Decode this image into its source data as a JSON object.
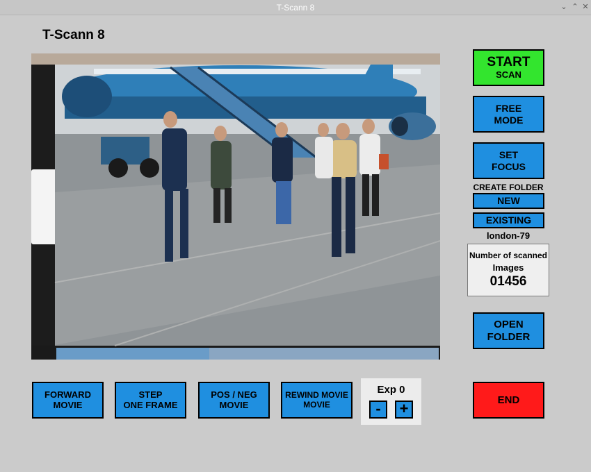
{
  "window": {
    "title": "T-Scann 8"
  },
  "app": {
    "title": "T-Scann 8"
  },
  "buttons": {
    "start_line1": "START",
    "start_line2": "SCAN",
    "free_line1": "FREE",
    "free_line2": "MODE",
    "focus_line1": "SET",
    "focus_line2": "FOCUS",
    "new": "NEW",
    "existing": "EXISTING",
    "open_line1": "OPEN",
    "open_line2": "FOLDER",
    "end": "END",
    "forward_line1": "FORWARD",
    "forward_line2": "MOVIE",
    "step_line1": "STEP",
    "step_line2": "ONE FRAME",
    "posneg_line1": "POS / NEG",
    "posneg_line2": "MOVIE",
    "rewind_line1": "REWIND MOVIE",
    "rewind_line2": "MOVIE"
  },
  "folder": {
    "create_label": "CREATE FOLDER",
    "current": "london-79"
  },
  "counter": {
    "label_line1": "Number of scanned",
    "label_line2": "Images",
    "value": "01456"
  },
  "exposure": {
    "label": "Exp 0",
    "minus": "-",
    "plus": "+"
  },
  "colors": {
    "start": "#33e52e",
    "blue": "#1f8fe0",
    "end": "#ff1a1a",
    "background": "#cbcbcb"
  },
  "icons": [
    "minimize-icon",
    "maximize-icon",
    "close-icon"
  ]
}
